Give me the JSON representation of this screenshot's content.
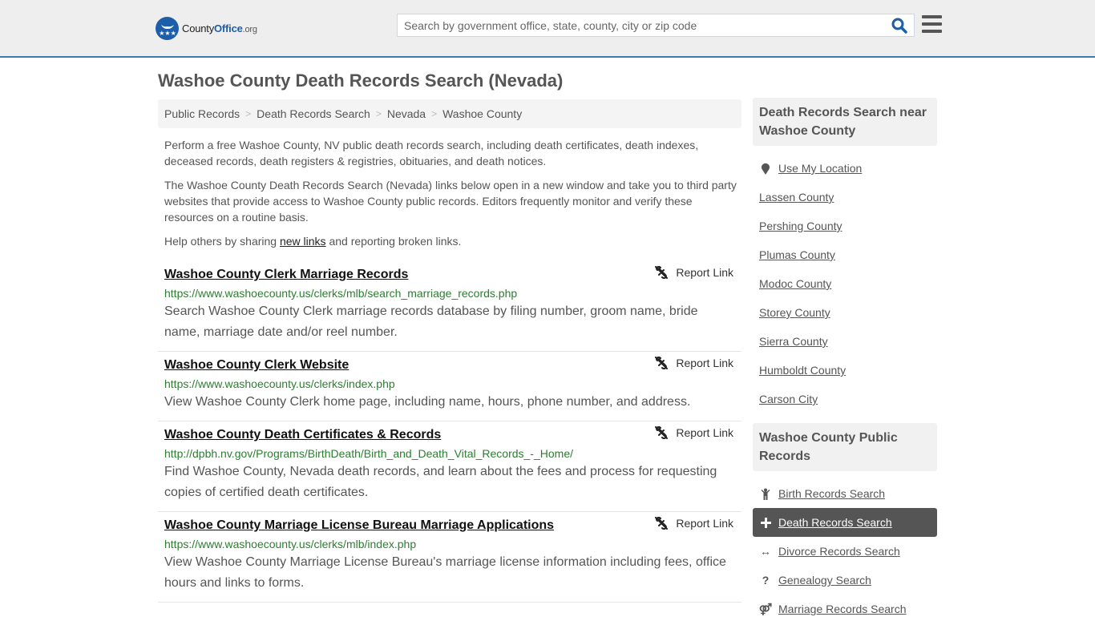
{
  "header": {
    "logo": {
      "name_part1": "County",
      "name_part2": "Office",
      "tld": ".org"
    },
    "search": {
      "placeholder": "Search by government office, state, county, city or zip code",
      "value": ""
    },
    "search_icon": "search-icon",
    "menu_icon": "hamburger-menu-icon"
  },
  "page": {
    "title": "Washoe County Death Records Search (Nevada)"
  },
  "breadcrumb": [
    {
      "label": "Public Records"
    },
    {
      "label": "Death Records Search"
    },
    {
      "label": "Nevada"
    },
    {
      "label": "Washoe County"
    }
  ],
  "intro": {
    "p1": "Perform a free Washoe County, NV public death records search, including death certificates, death indexes, deceased records, death registers & registries, obituaries, and death notices.",
    "p2": "The Washoe County Death Records Search (Nevada) links below open in a new window and take you to third party websites that provide access to Washoe County public records. Editors frequently monitor and verify these resources on a routine basis.",
    "p3_before": "Help others by sharing ",
    "p3_link": "new links",
    "p3_after": " and reporting broken links."
  },
  "results": [
    {
      "title": "Washoe County Clerk Marriage Records",
      "url": "https://www.washoecounty.us/clerks/mlb/search_marriage_records.php",
      "description": "Search Washoe County Clerk marriage records database by filing number, groom name, bride name, marriage date and/or reel number.",
      "report_label": "Report Link"
    },
    {
      "title": "Washoe County Clerk Website",
      "url": "https://www.washoecounty.us/clerks/index.php",
      "description": "View Washoe County Clerk home page, including name, hours, phone number, and address.",
      "report_label": "Report Link"
    },
    {
      "title": "Washoe County Death Certificates & Records",
      "url": "http://dpbh.nv.gov/Programs/BirthDeath/Birth_and_Death_Vital_Records_-_Home/",
      "description": "Find Washoe County, Nevada death records, and learn about the fees and process for requesting copies of certified death certificates.",
      "report_label": "Report Link"
    },
    {
      "title": "Washoe County Marriage License Bureau Marriage Applications",
      "url": "https://www.washoecounty.us/clerks/mlb/index.php",
      "description": "View Washoe County Marriage License Bureau's marriage license information including fees, office hours and links to forms.",
      "report_label": "Report Link"
    }
  ],
  "sidebar": {
    "nearby": {
      "heading": "Death Records Search near Washoe County",
      "use_location": "Use My Location",
      "items": [
        {
          "label": "Lassen County"
        },
        {
          "label": "Pershing County"
        },
        {
          "label": "Plumas County"
        },
        {
          "label": "Modoc County"
        },
        {
          "label": "Storey County"
        },
        {
          "label": "Sierra County"
        },
        {
          "label": "Humboldt County"
        },
        {
          "label": "Carson City"
        }
      ]
    },
    "public_records": {
      "heading": "Washoe County Public Records",
      "items": [
        {
          "label": "Birth Records Search",
          "icon": "child-icon",
          "active": false
        },
        {
          "label": "Death Records Search",
          "icon": "plus-icon",
          "active": true
        },
        {
          "label": "Divorce Records Search",
          "icon": "arrows-horizontal-icon",
          "active": false
        },
        {
          "label": "Genealogy Search",
          "icon": "question-icon",
          "active": false
        },
        {
          "label": "Marriage Records Search",
          "icon": "marriage-symbol-icon",
          "active": false
        }
      ]
    }
  },
  "colors": {
    "brand_blue": "#1c5ea8",
    "header_border": "#3b7cb0",
    "url_green": "#2e7d32",
    "active_bg": "#555555"
  }
}
